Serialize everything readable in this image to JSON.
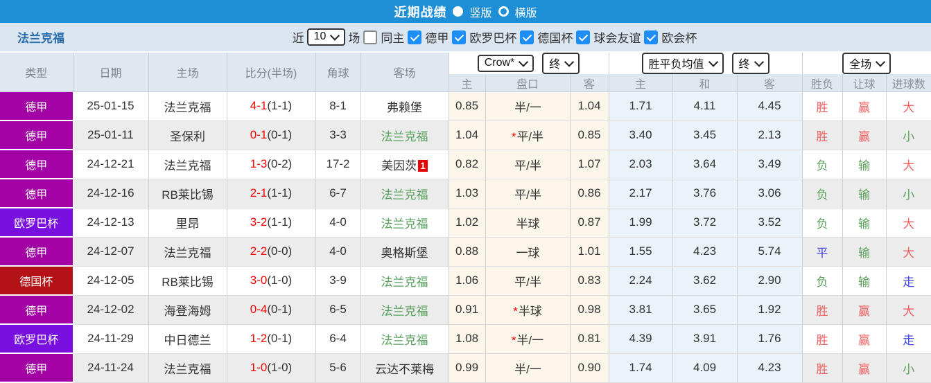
{
  "topbar": {
    "title": "近期战绩",
    "radios": [
      {
        "label": "竖版",
        "selected": true
      },
      {
        "label": "横版",
        "selected": false
      }
    ]
  },
  "filter": {
    "team": "法兰克福",
    "recent_label": "近",
    "recent_value": "10",
    "games_label": "场",
    "same_home_label": "同主",
    "same_home_checked": false,
    "leagues": [
      {
        "label": "德甲",
        "checked": true
      },
      {
        "label": "欧罗巴杯",
        "checked": true
      },
      {
        "label": "德国杯",
        "checked": true
      },
      {
        "label": "球会友谊",
        "checked": true
      },
      {
        "label": "欧会杯",
        "checked": true
      }
    ]
  },
  "header": {
    "main_columns": [
      "类型",
      "日期",
      "主场",
      "比分(半场)",
      "角球",
      "客场"
    ],
    "sub_columns": [
      "主",
      "盘口",
      "客",
      "主",
      "和",
      "客",
      "胜负",
      "让球",
      "进球数"
    ],
    "dropdowns": {
      "bookmaker": "Crow*",
      "final1": "终",
      "mean": "胜平负均值",
      "final2": "终",
      "scope": "全场"
    }
  },
  "maps": {
    "league_colors": {
      "德甲": "#a300a6",
      "欧罗巴杯": "#7a10e0",
      "德国杯": "#b31316"
    },
    "outcome_colors": {
      "胜": "#f06060",
      "负": "#58a058",
      "平": "#4545ee",
      "赢": "#f06060",
      "输": "#58a058",
      "大": "#f06060",
      "小": "#58a058",
      "走": "#4545ee"
    }
  },
  "rows": [
    {
      "league": "德甲",
      "date": "25-01-15",
      "home": "法兰克福",
      "score": "4-1",
      "half": "(1-1)",
      "corner": "8-1",
      "away": "弗赖堡",
      "away_badge": "",
      "h_home": "0.85",
      "star": false,
      "handicap": "半/一",
      "h_away": "1.04",
      "m_home": "1.71",
      "m_draw": "4.11",
      "m_away": "4.45",
      "result": "胜",
      "rlet": "赢",
      "goals": "大"
    },
    {
      "league": "德甲",
      "date": "25-01-11",
      "home": "圣保利",
      "score": "0-1",
      "half": "(0-1)",
      "corner": "3-3",
      "away": "法兰克福",
      "away_badge": "",
      "h_home": "1.04",
      "star": true,
      "handicap": "平/半",
      "h_away": "0.85",
      "m_home": "3.40",
      "m_draw": "3.45",
      "m_away": "2.13",
      "result": "胜",
      "rlet": "赢",
      "goals": "小"
    },
    {
      "league": "德甲",
      "date": "24-12-21",
      "home": "法兰克福",
      "score": "1-3",
      "half": "(0-2)",
      "corner": "17-2",
      "away": "美因茨",
      "away_badge": "1",
      "h_home": "0.82",
      "star": false,
      "handicap": "平/半",
      "h_away": "1.07",
      "m_home": "2.03",
      "m_draw": "3.64",
      "m_away": "3.49",
      "result": "负",
      "rlet": "输",
      "goals": "大"
    },
    {
      "league": "德甲",
      "date": "24-12-16",
      "home": "RB莱比锡",
      "score": "2-1",
      "half": "(1-1)",
      "corner": "6-7",
      "away": "法兰克福",
      "away_badge": "",
      "h_home": "1.03",
      "star": false,
      "handicap": "平/半",
      "h_away": "0.86",
      "m_home": "2.17",
      "m_draw": "3.76",
      "m_away": "3.06",
      "result": "负",
      "rlet": "输",
      "goals": "小"
    },
    {
      "league": "欧罗巴杯",
      "date": "24-12-13",
      "home": "里昂",
      "score": "3-2",
      "half": "(1-1)",
      "corner": "4-0",
      "away": "法兰克福",
      "away_badge": "",
      "h_home": "1.02",
      "star": false,
      "handicap": "半球",
      "h_away": "0.87",
      "m_home": "1.99",
      "m_draw": "3.72",
      "m_away": "3.52",
      "result": "负",
      "rlet": "输",
      "goals": "大"
    },
    {
      "league": "德甲",
      "date": "24-12-07",
      "home": "法兰克福",
      "score": "2-2",
      "half": "(0-0)",
      "corner": "4-0",
      "away": "奥格斯堡",
      "away_badge": "",
      "h_home": "0.88",
      "star": false,
      "handicap": "一球",
      "h_away": "1.01",
      "m_home": "1.55",
      "m_draw": "4.23",
      "m_away": "5.74",
      "result": "平",
      "rlet": "输",
      "goals": "大"
    },
    {
      "league": "德国杯",
      "date": "24-12-05",
      "home": "RB莱比锡",
      "score": "3-0",
      "half": "(1-0)",
      "corner": "3-9",
      "away": "法兰克福",
      "away_badge": "",
      "h_home": "1.06",
      "star": false,
      "handicap": "平/半",
      "h_away": "0.83",
      "m_home": "2.24",
      "m_draw": "3.62",
      "m_away": "2.90",
      "result": "负",
      "rlet": "输",
      "goals": "走"
    },
    {
      "league": "德甲",
      "date": "24-12-02",
      "home": "海登海姆",
      "score": "0-4",
      "half": "(0-1)",
      "corner": "6-5",
      "away": "法兰克福",
      "away_badge": "",
      "h_home": "0.91",
      "star": true,
      "handicap": "半球",
      "h_away": "0.98",
      "m_home": "3.81",
      "m_draw": "3.65",
      "m_away": "1.92",
      "result": "胜",
      "rlet": "赢",
      "goals": "大"
    },
    {
      "league": "欧罗巴杯",
      "date": "24-11-29",
      "home": "中日德兰",
      "score": "1-2",
      "half": "(0-1)",
      "corner": "6-4",
      "away": "法兰克福",
      "away_badge": "",
      "h_home": "1.08",
      "star": true,
      "handicap": "半/一",
      "h_away": "0.81",
      "m_home": "4.39",
      "m_draw": "3.91",
      "m_away": "1.76",
      "result": "胜",
      "rlet": "赢",
      "goals": "走"
    },
    {
      "league": "德甲",
      "date": "24-11-24",
      "home": "法兰克福",
      "score": "1-0",
      "half": "(1-0)",
      "corner": "5-6",
      "away": "云达不莱梅",
      "away_badge": "",
      "h_home": "0.99",
      "star": false,
      "handicap": "半/一",
      "h_away": "0.90",
      "m_home": "1.74",
      "m_draw": "4.09",
      "m_away": "4.23",
      "result": "胜",
      "rlet": "赢",
      "goals": "小"
    }
  ]
}
